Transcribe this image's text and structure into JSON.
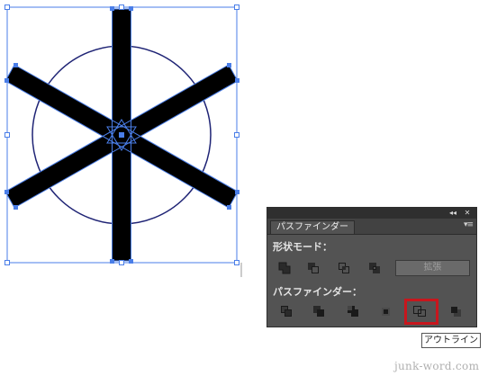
{
  "panel": {
    "collapse_glyph": "◂◂",
    "close_glyph": "✕",
    "tab_title": "パスファインダー",
    "menu_glyph": "▾≡",
    "shape_modes_label": "形状モード：",
    "shape_mode_buttons": [
      "unite-icon",
      "minus-front-icon",
      "intersect-icon",
      "exclude-icon"
    ],
    "expand_label": "拡張",
    "pathfinders_label": "パスファインダー：",
    "pathfinder_buttons": [
      "divide-icon",
      "trim-icon",
      "merge-icon",
      "crop-icon",
      "outline-icon",
      "minus-back-icon"
    ],
    "highlighted_button": "outline-icon",
    "highlight_color": "#c8161d"
  },
  "tooltip": {
    "text": "アウトライン"
  },
  "watermark": {
    "text": "junk-word.com"
  },
  "artboard": {
    "selection_color": "#4a7ee8",
    "circle_color": "#1f2475",
    "stroke_fill_color": "#000000"
  }
}
